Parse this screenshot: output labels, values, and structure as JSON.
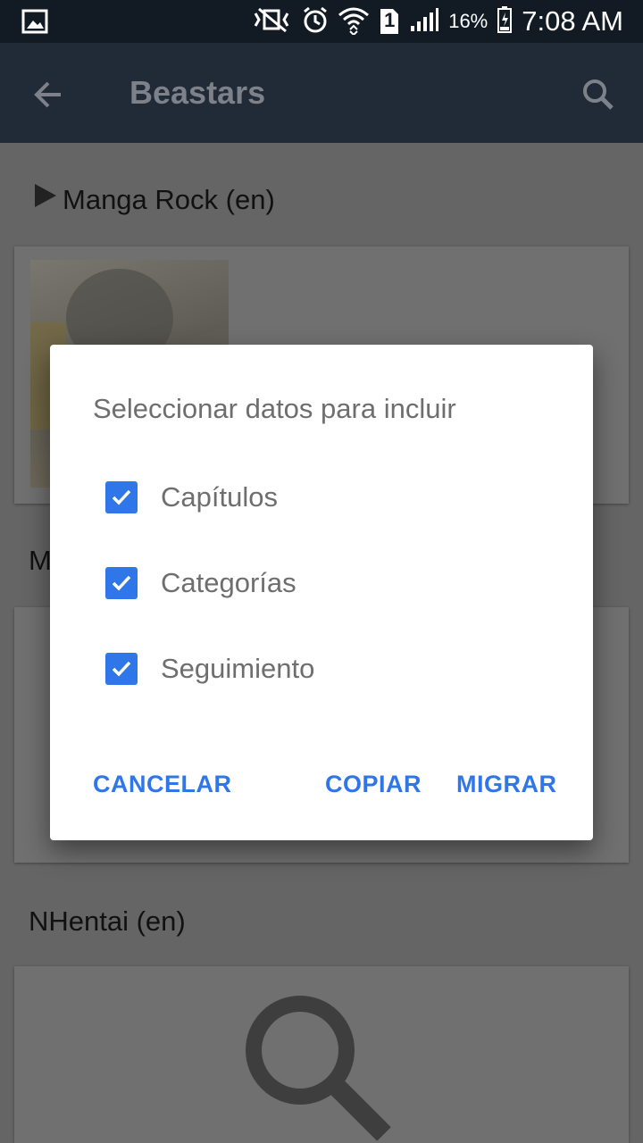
{
  "status_bar": {
    "battery_percent": "16%",
    "sim_badge": "1",
    "time": "7:08 AM",
    "icons": [
      "image-icon",
      "mute-vibrate-icon",
      "alarm-icon",
      "wifi-icon",
      "sim-icon",
      "signal-icon",
      "battery-icon"
    ]
  },
  "toolbar": {
    "title": "Beastars"
  },
  "background": {
    "sections": [
      {
        "title": "Manga Rock (en)"
      },
      {
        "title": "M"
      },
      {
        "title": "NHentai (en)"
      }
    ]
  },
  "dialog": {
    "title": "Seleccionar datos para incluir",
    "options": [
      {
        "label": "Capítulos",
        "checked": true
      },
      {
        "label": "Categorías",
        "checked": true
      },
      {
        "label": "Seguimiento",
        "checked": true
      }
    ],
    "buttons": {
      "cancel": "CANCELAR",
      "copy": "COPIAR",
      "migrate": "MIGRAR"
    }
  },
  "colors": {
    "accent": "#2f77e8",
    "toolbar": "#212a37",
    "status_bar": "#121a24"
  }
}
